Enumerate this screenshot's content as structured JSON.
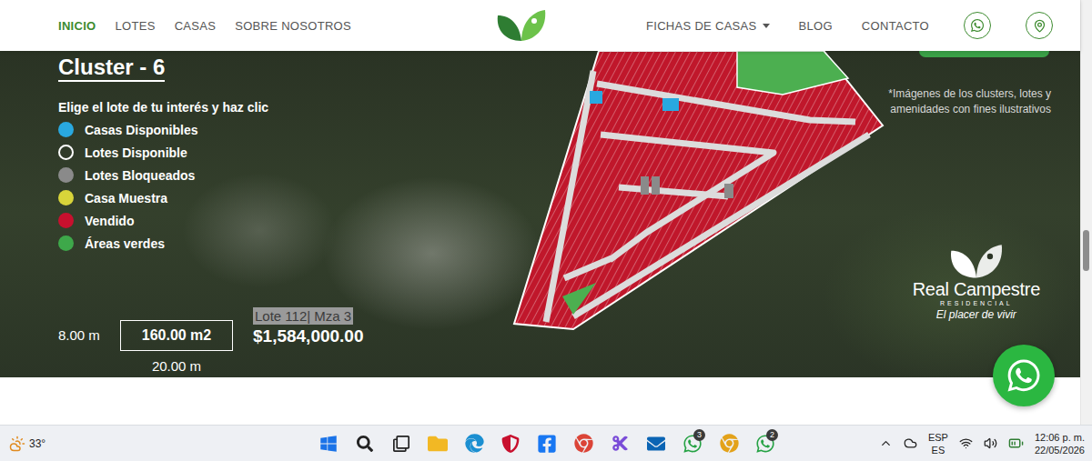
{
  "nav": {
    "left": [
      {
        "label": "INICIO",
        "selected": true
      },
      {
        "label": "LOTES",
        "selected": false
      },
      {
        "label": "CASAS",
        "selected": false
      },
      {
        "label": "SOBRE NOSOTROS",
        "selected": false
      }
    ],
    "right": [
      {
        "label": "FICHAS DE CASAS",
        "dropdown": true
      },
      {
        "label": "BLOG",
        "dropdown": false
      },
      {
        "label": "CONTACTO",
        "dropdown": false
      }
    ]
  },
  "scrollbar": {
    "level": 0.6
  },
  "hero": {
    "title": "Cluster - 6",
    "instruction": "Elige el lote de tu interés y haz clic",
    "legend": [
      {
        "label": "Casas Disponibles",
        "color": "#29a8e0",
        "kind": "filled"
      },
      {
        "label": "Lotes Disponible",
        "color": "#ffffff",
        "kind": "outline"
      },
      {
        "label": "Lotes Bloqueados",
        "color": "#8a8a8a",
        "kind": "filled"
      },
      {
        "label": "Casa Muestra",
        "color": "#d8d43a",
        "kind": "filled"
      },
      {
        "label": "Vendido",
        "color": "#c8102e",
        "kind": "filled"
      },
      {
        "label": "Áreas verdes",
        "color": "#3ea84a",
        "kind": "filled"
      }
    ],
    "lot": {
      "front": "8.00 m",
      "area": "160.00 m2",
      "depth": "20.00 m",
      "name": "Lote 112| Mza 3",
      "price": "$1,584,000.00"
    },
    "note": "*Imágenes de los clusters, lotes y amenidades con fines ilustrativos",
    "brand": {
      "name": "Real Campestre",
      "sub": "RESIDENCIAL",
      "tagline": "El placer de vivir"
    }
  },
  "taskbar": {
    "weather": "33°",
    "apps": [
      {},
      {},
      {},
      {},
      {},
      {},
      {},
      {},
      {},
      {},
      {
        "badge": "3"
      },
      {},
      {
        "badge": "2"
      }
    ],
    "tray": {
      "lang": "ESP",
      "region": "ES",
      "time": "12:06 p. m.",
      "date": "22/05/2026"
    }
  }
}
